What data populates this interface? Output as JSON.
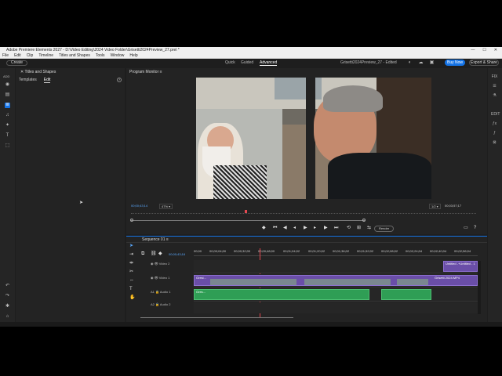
{
  "window": {
    "title": "Adobe Premiere Elements 2027 - D:\\Video Editing\\2024 Video Folder\\Grisetti2024Preview_27.prel *",
    "min": "—",
    "max": "☐",
    "close": "✕"
  },
  "menu": [
    "File",
    "Edit",
    "Clip",
    "Timeline",
    "Titles and Shapes",
    "Tools",
    "Window",
    "Help"
  ],
  "topbar": {
    "create": "Create",
    "modes": [
      "Quick",
      "Guided",
      "Advanced"
    ],
    "active_mode": "Advanced",
    "doc_title": "Grisetti2024Preview_27 - Edited",
    "buy": "Buy Now",
    "export": "Export & Share"
  },
  "left_tools": {
    "label": "ADD",
    "icons": [
      "media-icon",
      "bin-icon",
      "audio-icon",
      "timeline-tools-icon",
      "music-icon",
      "effects-icon",
      "titles-icon",
      "graphics-icon",
      "adjust-icon"
    ]
  },
  "left_panel": {
    "title": "Titles and Shapes",
    "tabs": [
      "Templates",
      "Edit"
    ],
    "active_tab": "Edit",
    "help": "?"
  },
  "monitor": {
    "title": "Program Monitor",
    "menu_icon": "≡",
    "timecode": "00;00;43;14",
    "zoom": "47%",
    "quality": "1/2",
    "duration": "00;03;57;17",
    "render": "Render"
  },
  "timeline": {
    "sequence": "Sequence 01",
    "menu_icon": "≡",
    "timecode": "00;00;43;16",
    "ruler": [
      "00;00",
      "00;00;04;00",
      "00;00;32;00",
      "00;00;48;00",
      "00;01;04;02",
      "00;01;20;02",
      "00;01;36;02",
      "00;01;52;02",
      "00;02;08;02",
      "00;02;24;04",
      "00;02;40;04",
      "00;02;56;04",
      "00;03;12;04",
      "00;03;28;04",
      "00;03;44;04"
    ],
    "tracks": [
      {
        "label": "Video 2"
      },
      {
        "label": "Video 1"
      },
      {
        "label": "Audio 1"
      },
      {
        "label": "Audio 2"
      }
    ],
    "clip_labels": {
      "v2": "Untitled -+Untitled - 1",
      "v1_start": "Gresi...",
      "v1_end": "Grisetti 2024.MP4",
      "a1_start": "Gres..."
    }
  },
  "right_tools": [
    "FIX",
    "ADJ",
    "EDIT",
    "FX",
    "APPLIED-FX"
  ],
  "colors": {
    "accent": "#1473e6",
    "video_clip": "#6a4ea8",
    "audio_clip": "#2f9e55",
    "playhead": "#e34850",
    "timecode": "#5aa9ff"
  }
}
